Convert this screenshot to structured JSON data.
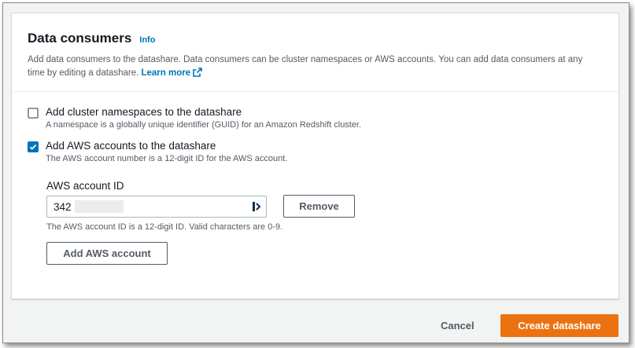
{
  "panel": {
    "title": "Data consumers",
    "info_label": "Info",
    "description": "Add data consumers to the datashare. Data consumers can be cluster namespaces or AWS accounts. You can add data consumers at any time by editing a datashare.",
    "learn_more": "Learn more"
  },
  "options": [
    {
      "label": "Add cluster namespaces to the datashare",
      "description": "A namespace is a globally unique identifier (GUID) for an Amazon Redshift cluster.",
      "checked": false
    },
    {
      "label": "Add AWS accounts to the datashare",
      "description": "The AWS account number is a 12-digit ID for the AWS account.",
      "checked": true
    }
  ],
  "account_field": {
    "label": "AWS account ID",
    "value": "342",
    "hint": "The AWS account ID is a 12-digit ID. Valid characters are 0-9.",
    "remove_label": "Remove",
    "add_label": "Add AWS account"
  },
  "footer": {
    "cancel_label": "Cancel",
    "create_label": "Create datashare"
  },
  "colors": {
    "link": "#0073bb",
    "checkbox_checked": "#0073bb",
    "primary_button": "#ec7211"
  }
}
